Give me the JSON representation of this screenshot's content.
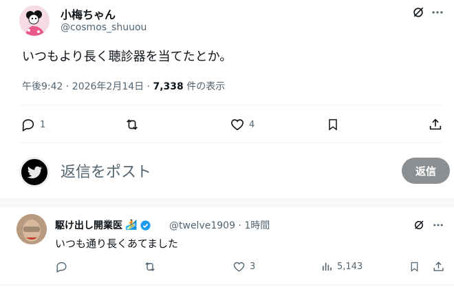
{
  "tweet": {
    "display_name": "小梅ちゃん",
    "handle": "@cosmos_shuuou",
    "text": "いつもより長く聴診器を当てたとか。",
    "time": "午後9:42 · 2026年2月14日 · ",
    "views_count": "7,338",
    "views_suffix": " 件の表示",
    "replies": "1",
    "likes": "4"
  },
  "compose": {
    "placeholder": "返信をポスト",
    "button": "返信"
  },
  "reply": {
    "display_name": "駆け出し開業医",
    "emoji": "🏄",
    "handle_time": "@twelve1909 · 1時間",
    "text": "いつも通り長くあてました",
    "likes": "3",
    "views": "5,143"
  },
  "colors": {
    "accent": "#1d9bf0",
    "muted": "#536471",
    "button_disabled": "#8b8f92"
  }
}
